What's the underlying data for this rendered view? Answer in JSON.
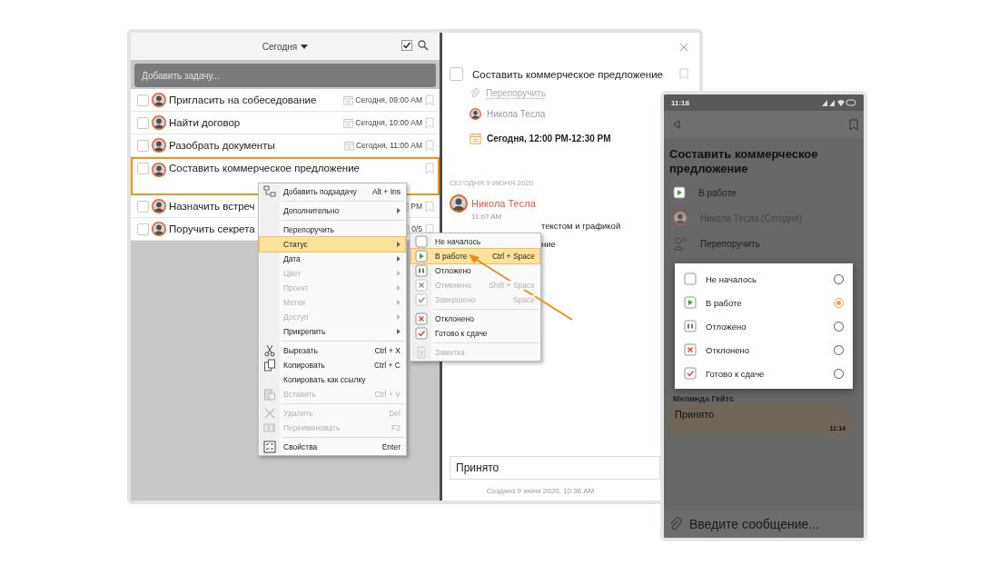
{
  "desktop": {
    "filter": "Сегодня",
    "add_task": {
      "placeholder": "Добавить задачу..."
    },
    "tasks": [
      {
        "title": "Пригласить на собеседование",
        "due": "Сегодня, 09:00 AM",
        "selected": false
      },
      {
        "title": "Найти договор",
        "due": "Сегодня, 10:00 AM",
        "selected": false
      },
      {
        "title": "Разобрать документы",
        "due": "Сегодня, 11:00 AM",
        "selected": false
      },
      {
        "title": "Составить коммерческое предложение",
        "selected": true
      },
      {
        "title": "Назначить встреч",
        "due": "PM",
        "selected": false
      },
      {
        "title": "Поручить секрета",
        "due": "0/5",
        "selected": false
      }
    ],
    "context_menu": {
      "groups": [
        [
          {
            "kind": "subtask",
            "label": "Добавить подзадачу",
            "shortcut": "Alt + Ins",
            "submenu": false,
            "disabled": false,
            "selected": false
          }
        ],
        [
          {
            "kind": "plain",
            "label": "Дополнительно",
            "submenu": true,
            "disabled": false,
            "selected": false
          }
        ],
        [
          {
            "kind": "plain",
            "label": "Перепоручить",
            "submenu": false,
            "disabled": false,
            "selected": false
          },
          {
            "kind": "plain",
            "label": "Статус",
            "submenu": true,
            "disabled": false,
            "selected": true
          },
          {
            "kind": "plain",
            "label": "Дата",
            "submenu": true,
            "disabled": false,
            "selected": false
          },
          {
            "kind": "plain",
            "label": "Цвет",
            "submenu": true,
            "disabled": true,
            "selected": false
          },
          {
            "kind": "plain",
            "label": "Проект",
            "submenu": true,
            "disabled": true,
            "selected": false
          },
          {
            "kind": "plain",
            "label": "Метки",
            "submenu": true,
            "disabled": true,
            "selected": false
          },
          {
            "kind": "plain",
            "label": "Доступ",
            "submenu": true,
            "disabled": true,
            "selected": false
          },
          {
            "kind": "plain",
            "label": "Прикрепить",
            "submenu": true,
            "disabled": false,
            "selected": false
          }
        ],
        [
          {
            "kind": "cut",
            "label": "Вырезать",
            "shortcut": "Ctrl + X",
            "submenu": false,
            "disabled": false,
            "selected": false
          },
          {
            "kind": "copy",
            "label": "Копировать",
            "shortcut": "Ctrl + C",
            "submenu": false,
            "disabled": false,
            "selected": false
          },
          {
            "kind": "plain",
            "label": "Копировать как ссылку",
            "submenu": false,
            "disabled": false,
            "selected": false
          },
          {
            "kind": "paste",
            "label": "Вставить",
            "shortcut": "Ctrl + V",
            "submenu": false,
            "disabled": true,
            "selected": false
          }
        ],
        [
          {
            "kind": "delete",
            "label": "Удалить",
            "shortcut": "Del",
            "submenu": false,
            "disabled": true,
            "selected": false
          },
          {
            "kind": "rename",
            "label": "Переименовать",
            "shortcut": "F2",
            "submenu": false,
            "disabled": true,
            "selected": false
          }
        ],
        [
          {
            "kind": "properties",
            "label": "Свойства",
            "shortcut": "Enter",
            "submenu": false,
            "disabled": false,
            "selected": false
          }
        ]
      ]
    },
    "status_menu": {
      "groups": [
        [
          {
            "kind": "not_started",
            "label": "Не началось",
            "disabled": false,
            "selected": false
          },
          {
            "kind": "in_progress",
            "label": "В работе",
            "shortcut": "Ctrl + Space",
            "disabled": false,
            "selected": true
          },
          {
            "kind": "paused",
            "label": "Отложено",
            "disabled": false,
            "selected": false
          },
          {
            "kind": "cancelled",
            "label": "Отменено",
            "shortcut": "Shift + Space",
            "disabled": true,
            "selected": false
          },
          {
            "kind": "done",
            "label": "Завершено",
            "shortcut": "Space",
            "disabled": true,
            "selected": false
          }
        ],
        [
          {
            "kind": "rejected",
            "label": "Отклонено",
            "disabled": false,
            "selected": false
          },
          {
            "kind": "ready",
            "label": "Готово к сдаче",
            "disabled": false,
            "selected": false
          }
        ],
        [
          {
            "kind": "note",
            "label": "Заметка",
            "disabled": true,
            "selected": false
          }
        ]
      ]
    },
    "detail": {
      "checked": false,
      "title": "Составить коммерческое предложение",
      "reassign": "Перепоручить",
      "assignee": "Никола Тесла",
      "date": "Сегодня, 12:00 PM-12:30 PM",
      "feed_date": "СЕГОДНЯ 9 ИЮНЯ 2020",
      "author": "Никола Тесла",
      "time": "11:07 AM",
      "message_lines": [
        "текстом и графикой",
        "ние"
      ],
      "comment": "Принято",
      "created": "Создано 9 июня 2020, 10:36 AM"
    }
  },
  "phone": {
    "clock": "11:18",
    "title": "Составить коммерческое предложение",
    "status": "В работе",
    "assignee": "Никола Тесла (Сегодня)",
    "reassign": "Перепоручить",
    "status_options": [
      {
        "kind": "not_started",
        "label": "Не началось",
        "selected": false
      },
      {
        "kind": "in_progress",
        "label": "В работе",
        "selected": true
      },
      {
        "kind": "paused",
        "label": "Отложено",
        "selected": false
      },
      {
        "kind": "rejected",
        "label": "Отклонено",
        "selected": false
      },
      {
        "kind": "ready",
        "label": "Готово к сдаче",
        "selected": false
      }
    ],
    "sender": "Мелинда Гейтс",
    "bubble": {
      "text": "Принято",
      "time": "11:14"
    },
    "input": {
      "placeholder": "Введите сообщение..."
    }
  }
}
